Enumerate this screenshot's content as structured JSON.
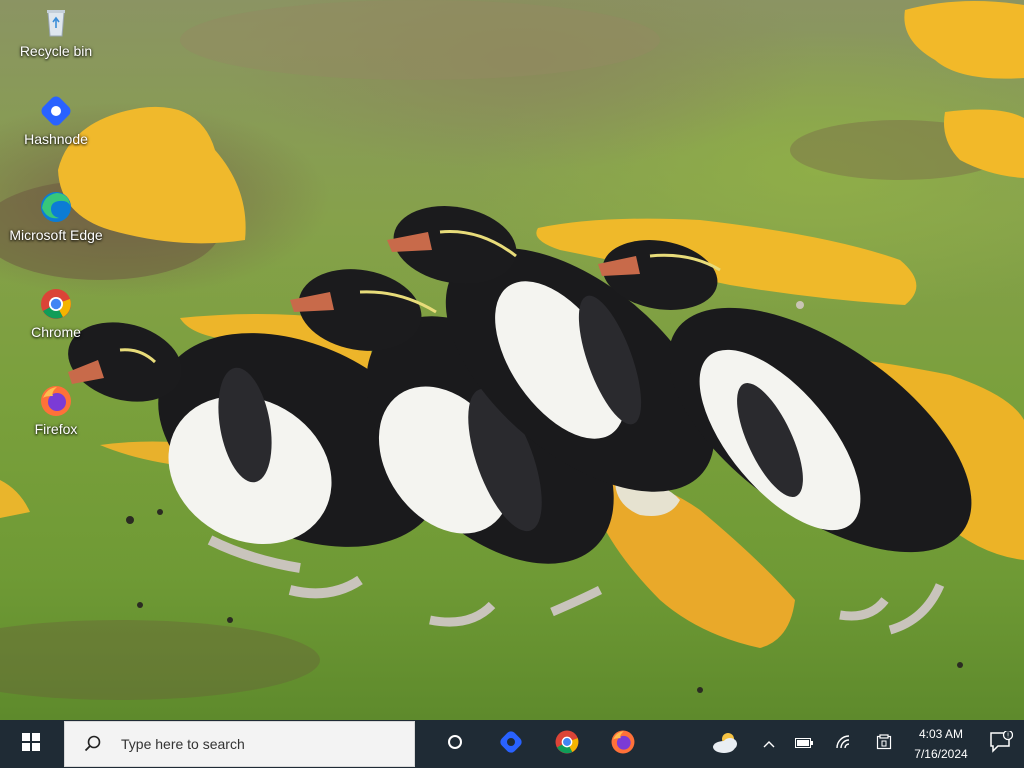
{
  "desktop": {
    "icons": [
      {
        "label": "Recycle bin",
        "icon": "recycle-bin-icon"
      },
      {
        "label": "Hashnode",
        "icon": "hashnode-icon"
      },
      {
        "label": "Microsoft Edge",
        "icon": "edge-icon"
      },
      {
        "label": "Chrome",
        "icon": "chrome-icon"
      },
      {
        "label": "Firefox",
        "icon": "firefox-icon"
      }
    ]
  },
  "taskbar": {
    "search_placeholder": "Type here to search",
    "pinned": [
      "task-view-icon",
      "hashnode-icon",
      "chrome-icon",
      "firefox-icon"
    ],
    "tray": [
      "weather-icon",
      "chevron-up-icon",
      "battery-icon",
      "wifi-icon",
      "tablet-mode-icon"
    ],
    "clock": {
      "time": "4:03 AM",
      "date": "7/16/2024"
    },
    "notifications": "notification-center-icon",
    "colors": {
      "background": "#1f2b35",
      "search_bg": "#f3f3f3"
    }
  }
}
